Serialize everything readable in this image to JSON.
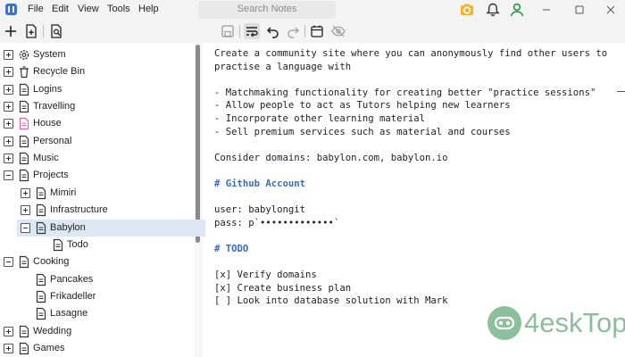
{
  "menu": [
    "File",
    "Edit",
    "View",
    "Tools",
    "Help"
  ],
  "search": {
    "placeholder": "Search Notes"
  },
  "colors": {
    "accent": "#3c73c9",
    "selection": "#dde7f3",
    "heading": "#3a6bb5",
    "watermark": "#2e8b4a",
    "notification": "#f2b233",
    "user": "#2e9a4a"
  },
  "sidebar": {
    "items": [
      {
        "label": "System",
        "level": 0,
        "expander": "plus",
        "icon": "gear-icon"
      },
      {
        "label": "Recycle Bin",
        "level": 0,
        "expander": "plus",
        "icon": "trash-icon"
      },
      {
        "label": "Logins",
        "level": 0,
        "expander": "plus",
        "icon": "note-icon"
      },
      {
        "label": "Travelling",
        "level": 0,
        "expander": "plus",
        "icon": "note-icon"
      },
      {
        "label": "House",
        "level": 0,
        "expander": "plus",
        "icon": "note-icon-pink"
      },
      {
        "label": "Personal",
        "level": 0,
        "expander": "plus",
        "icon": "note-icon"
      },
      {
        "label": "Music",
        "level": 0,
        "expander": "plus",
        "icon": "note-icon"
      },
      {
        "label": "Projects",
        "level": 0,
        "expander": "minus",
        "icon": "note-icon"
      },
      {
        "label": "Mimiri",
        "level": 1,
        "expander": "plus",
        "icon": "note-icon"
      },
      {
        "label": "Infrastructure",
        "level": 1,
        "expander": "plus",
        "icon": "note-icon"
      },
      {
        "label": "Babylon",
        "level": 1,
        "expander": "minus",
        "icon": "note-icon",
        "selected": true
      },
      {
        "label": "Todo",
        "level": 2,
        "expander": "none",
        "icon": "note-icon"
      },
      {
        "label": "Cooking",
        "level": 0,
        "expander": "minus",
        "icon": "note-icon"
      },
      {
        "label": "Pancakes",
        "level": 1,
        "expander": "none",
        "icon": "note-icon"
      },
      {
        "label": "Frikadeller",
        "level": 1,
        "expander": "none",
        "icon": "note-icon"
      },
      {
        "label": "Lasagne",
        "level": 1,
        "expander": "none",
        "icon": "note-icon"
      },
      {
        "label": "Wedding",
        "level": 0,
        "expander": "plus",
        "icon": "note-icon"
      },
      {
        "label": "Games",
        "level": 0,
        "expander": "plus",
        "icon": "note-icon"
      }
    ]
  },
  "editor": {
    "lines": [
      {
        "text": "Create a community site where you can anonymously find other users to",
        "style": "normal"
      },
      {
        "text": "practise a language with",
        "style": "normal"
      },
      {
        "text": "",
        "style": "normal"
      },
      {
        "text": "- Matchmaking functionality for creating better \"practice sessions\"",
        "style": "normal"
      },
      {
        "text": "- Allow people to act as Tutors helping new learners",
        "style": "normal"
      },
      {
        "text": "- Incorporate other learning material",
        "style": "normal"
      },
      {
        "text": "- Sell premium services such as material and courses",
        "style": "normal"
      },
      {
        "text": "",
        "style": "normal"
      },
      {
        "text": "Consider domains: babylon.com, babylon.io",
        "style": "normal"
      },
      {
        "text": "",
        "style": "normal"
      },
      {
        "text": "# Github Account",
        "style": "heading"
      },
      {
        "text": "",
        "style": "normal"
      },
      {
        "text": "user: babylongit",
        "style": "normal"
      },
      {
        "text": "pass: p`•••••••••••••`",
        "style": "normal"
      },
      {
        "text": "",
        "style": "normal"
      },
      {
        "text": "# TODO",
        "style": "heading"
      },
      {
        "text": "",
        "style": "normal"
      },
      {
        "text": "[x] Verify domains",
        "style": "normal"
      },
      {
        "text": "[x] Create business plan",
        "style": "normal"
      },
      {
        "text": "[ ] Look into database solution with Mark",
        "style": "normal"
      }
    ]
  },
  "watermark": {
    "text": "4eskTop"
  }
}
